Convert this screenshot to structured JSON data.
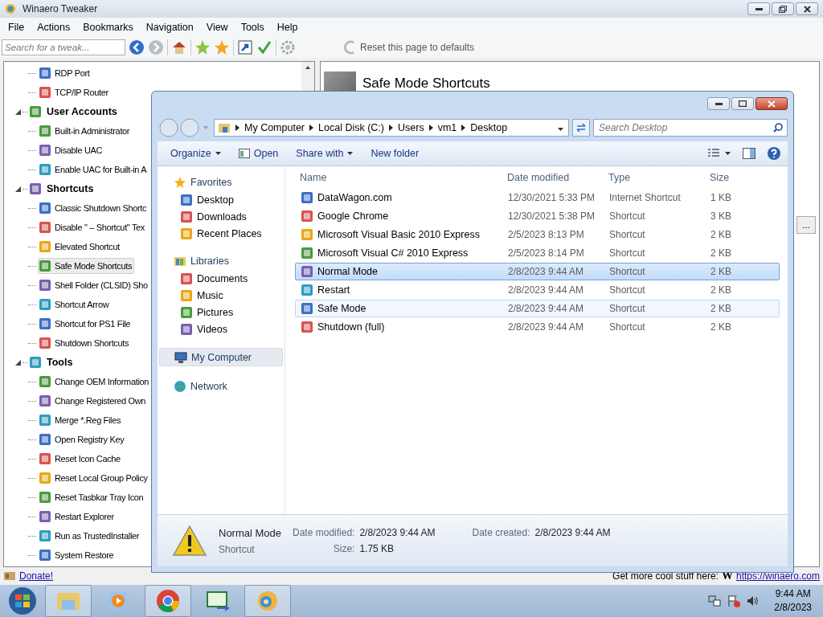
{
  "app_window": {
    "title": "Winaero Tweaker"
  },
  "menu": [
    "File",
    "Actions",
    "Bookmarks",
    "Navigation",
    "View",
    "Tools",
    "Help"
  ],
  "toolbar": {
    "search": {
      "placeholder": "Search for a tweak..."
    },
    "reset_label": "Reset this page to defaults"
  },
  "tree": {
    "items": [
      {
        "children": [
          {
            "label": "RDP Port",
            "selected": false
          },
          {
            "label": "TCP/IP Router",
            "selected": false
          }
        ]
      },
      {
        "label": "User Accounts",
        "expanded": true,
        "children": [
          {
            "label": "Built-in Administrator",
            "selected": false
          },
          {
            "label": "Disable UAC",
            "selected": false
          },
          {
            "label": "Enable UAC for Built-in A",
            "selected": false
          }
        ]
      },
      {
        "label": "Shortcuts",
        "expanded": true,
        "children": [
          {
            "label": "Classic Shutdown Shortc",
            "selected": false
          },
          {
            "label": "Disable \" – Shortcut\" Tex",
            "selected": false
          },
          {
            "label": "Elevated Shortcut",
            "selected": false
          },
          {
            "label": "Safe Mode Shortcuts",
            "selected": true
          },
          {
            "label": "Shell Folder (CLSID) Sho",
            "selected": false
          },
          {
            "label": "Shortcut Arrow",
            "selected": false
          },
          {
            "label": "Shortcut for PS1 File",
            "selected": false
          },
          {
            "label": "Shutdown Shortcuts",
            "selected": false
          }
        ]
      },
      {
        "label": "Tools",
        "expanded": true,
        "children": [
          {
            "label": "Change OEM Information",
            "selected": false
          },
          {
            "label": "Change Registered Own",
            "selected": false
          },
          {
            "label": "Merge *.Reg Files",
            "selected": false
          },
          {
            "label": "Open Registry Key",
            "selected": false
          },
          {
            "label": "Reset Icon Cache",
            "selected": false
          },
          {
            "label": "Reset Local Group Policy",
            "selected": false
          },
          {
            "label": "Reset Tasbkar Tray Icon",
            "selected": false
          },
          {
            "label": "Restart Explorer",
            "selected": false
          },
          {
            "label": "Run as TrustedInstaller",
            "selected": false
          },
          {
            "label": "System Restore",
            "selected": false
          }
        ]
      }
    ]
  },
  "page": {
    "title": "Safe Mode Shortcuts",
    "button": "..."
  },
  "footer": {
    "donate": "Donate!",
    "promo": "Get more cool stuff here:",
    "logo": "W",
    "link": "https://winaero.com"
  },
  "explorer": {
    "breadcrumb": [
      "My Computer",
      "Local Disk (C:)",
      "Users",
      "vm1",
      "Desktop"
    ],
    "search": {
      "placeholder": "Search Desktop"
    },
    "commands": [
      {
        "label": "Organize",
        "kind": "menu"
      },
      {
        "label": "Open",
        "kind": "icon"
      },
      {
        "label": "Share with",
        "kind": "menu"
      },
      {
        "label": "New folder",
        "kind": "plain"
      }
    ],
    "nav": [
      {
        "label": "Favorites",
        "kind": "star",
        "selected": false,
        "children": [
          {
            "label": "Desktop"
          },
          {
            "label": "Downloads"
          },
          {
            "label": "Recent Places"
          }
        ]
      },
      {
        "label": "Libraries",
        "kind": "library",
        "selected": false,
        "children": [
          {
            "label": "Documents"
          },
          {
            "label": "Music"
          },
          {
            "label": "Pictures"
          },
          {
            "label": "Videos"
          }
        ]
      },
      {
        "label": "My Computer",
        "kind": "computer",
        "selected": true
      },
      {
        "label": "Network",
        "kind": "network",
        "selected": false
      }
    ],
    "columns": [
      "Name",
      "Date modified",
      "Type",
      "Size"
    ],
    "files": [
      {
        "name": "DataWagon.com",
        "date": "12/30/2021 5:33 PM",
        "type": "Internet Shortcut",
        "size": "1 KB",
        "selected": false,
        "hovered": false
      },
      {
        "name": "Google Chrome",
        "date": "12/30/2021 5:38 PM",
        "type": "Shortcut",
        "size": "3 KB",
        "selected": false,
        "hovered": false
      },
      {
        "name": "Microsoft Visual Basic 2010 Express",
        "date": "2/5/2023 8:13 PM",
        "type": "Shortcut",
        "size": "2 KB",
        "selected": false,
        "hovered": false
      },
      {
        "name": "Microsoft Visual C# 2010 Express",
        "date": "2/5/2023 8:14 PM",
        "type": "Shortcut",
        "size": "2 KB",
        "selected": false,
        "hovered": false
      },
      {
        "name": "Normal Mode",
        "date": "2/8/2023 9:44 AM",
        "type": "Shortcut",
        "size": "2 KB",
        "selected": true,
        "hovered": false
      },
      {
        "name": "Restart",
        "date": "2/8/2023 9:44 AM",
        "type": "Shortcut",
        "size": "2 KB",
        "selected": false,
        "hovered": false
      },
      {
        "name": "Safe Mode",
        "date": "2/8/2023 9:44 AM",
        "type": "Shortcut",
        "size": "2 KB",
        "selected": false,
        "hovered": true
      },
      {
        "name": "Shutdown (full)",
        "date": "2/8/2023 9:44 AM",
        "type": "Shortcut",
        "size": "2 KB",
        "selected": false,
        "hovered": false
      }
    ],
    "details": {
      "name": "Normal Mode",
      "type": "Shortcut",
      "fields": [
        {
          "label": "Date modified:",
          "value": "2/8/2023 9:44 AM"
        },
        {
          "label": "Size:",
          "value": "1.75 KB"
        },
        {
          "label": "Date created:",
          "value": "2/8/2023 9:44 AM"
        }
      ]
    }
  },
  "taskbar": {
    "time": "9:44 AM",
    "date": "2/8/2023"
  }
}
